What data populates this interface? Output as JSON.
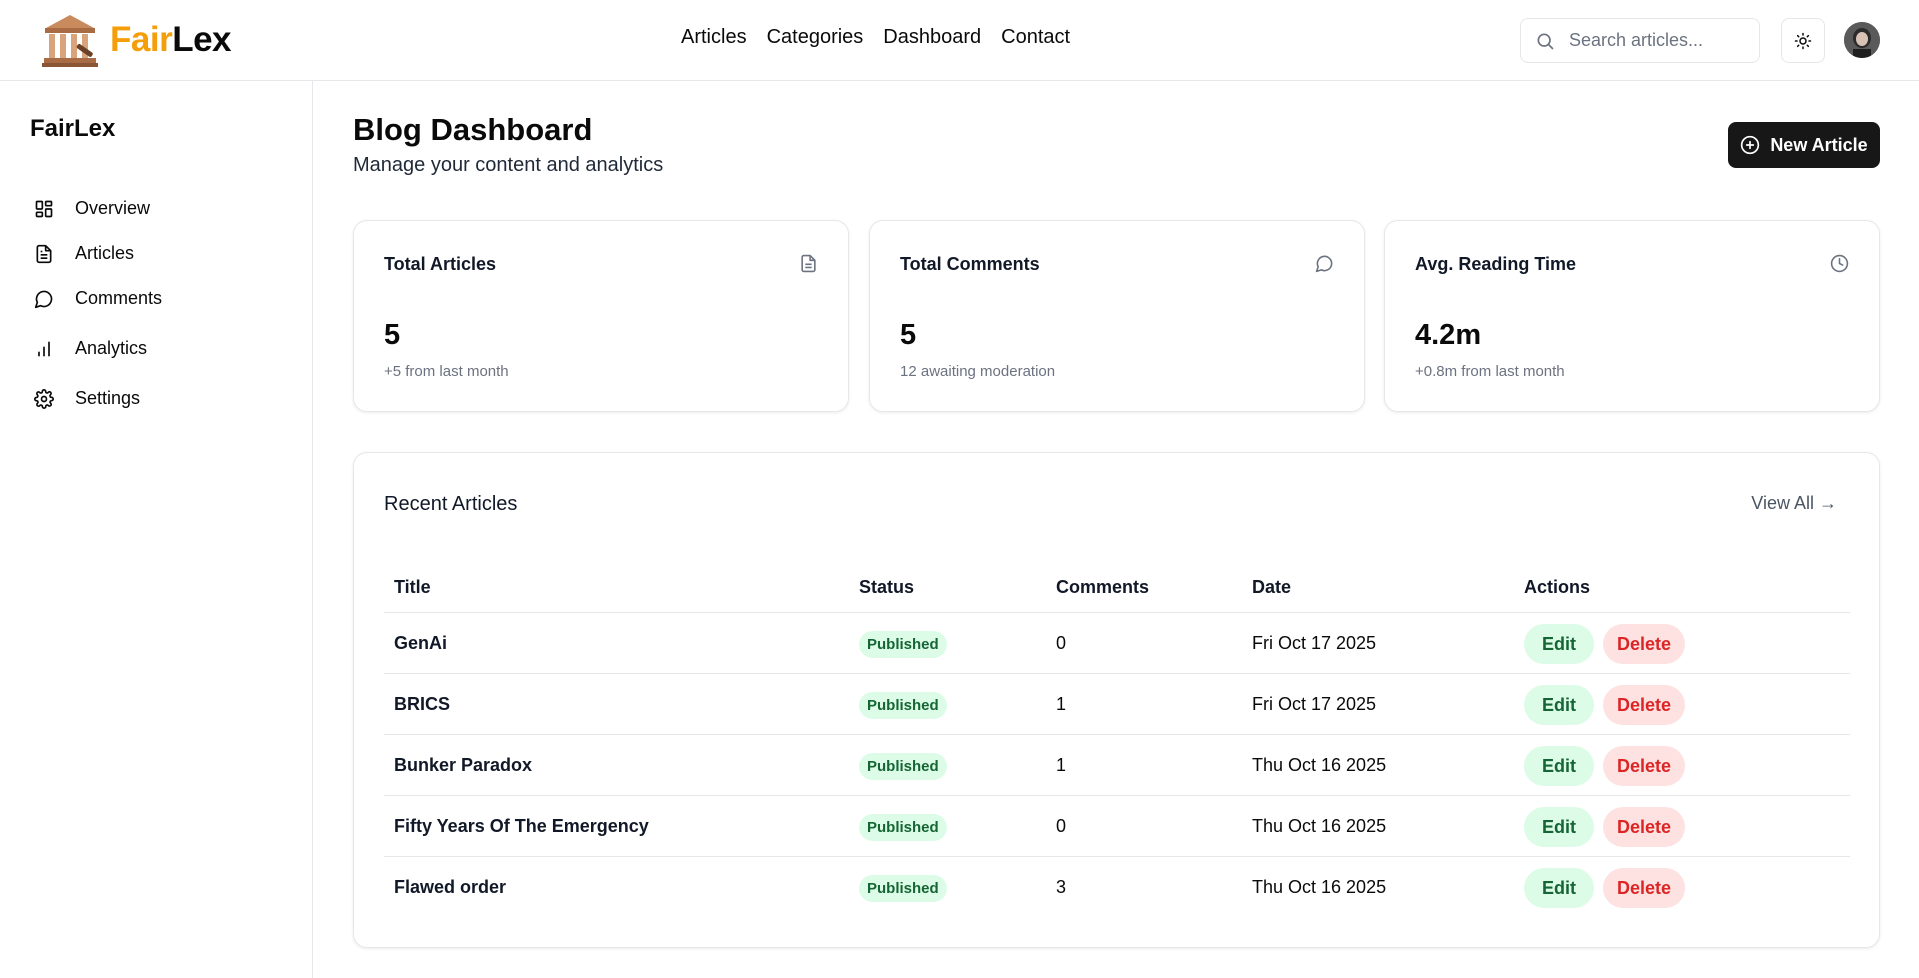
{
  "brand": {
    "part1": "Fair",
    "part2": "Lex",
    "part1_color": "#f59e0b"
  },
  "topnav": [
    "Articles",
    "Categories",
    "Dashboard",
    "Contact"
  ],
  "search": {
    "placeholder": "Search articles..."
  },
  "sidebar": {
    "title": "FairLex",
    "items": [
      {
        "label": "Overview",
        "icon": "grid-icon"
      },
      {
        "label": "Articles",
        "icon": "file-text-icon"
      },
      {
        "label": "Comments",
        "icon": "message-circle-icon"
      },
      {
        "label": "Analytics",
        "icon": "bar-chart-icon"
      },
      {
        "label": "Settings",
        "icon": "gear-icon"
      }
    ]
  },
  "main": {
    "title": "Blog Dashboard",
    "subtitle": "Manage your content and analytics",
    "new_article_label": "New Article"
  },
  "stats": [
    {
      "label": "Total Articles",
      "value": "5",
      "note": "+5 from last month",
      "icon": "file-text-icon"
    },
    {
      "label": "Total Comments",
      "value": "5",
      "note": "12 awaiting moderation",
      "icon": "message-circle-icon"
    },
    {
      "label": "Avg. Reading Time",
      "value": "4.2m",
      "note": "+0.8m from last month",
      "icon": "clock-icon"
    }
  ],
  "recent": {
    "title": "Recent Articles",
    "view_all": "View All →",
    "columns": [
      "Title",
      "Status",
      "Comments",
      "Date",
      "Actions"
    ],
    "rows": [
      {
        "title": "GenAi",
        "status": "Published",
        "comments": "0",
        "date": "Fri Oct 17 2025"
      },
      {
        "title": "BRICS",
        "status": "Published",
        "comments": "1",
        "date": "Fri Oct 17 2025"
      },
      {
        "title": "Bunker Paradox",
        "status": "Published",
        "comments": "1",
        "date": "Thu Oct 16 2025"
      },
      {
        "title": "Fifty Years Of The Emergency",
        "status": "Published",
        "comments": "0",
        "date": "Thu Oct 16 2025"
      },
      {
        "title": "Flawed order",
        "status": "Published",
        "comments": "3",
        "date": "Thu Oct 16 2025"
      }
    ],
    "edit_label": "Edit",
    "delete_label": "Delete"
  },
  "colors": {
    "accent": "#f59e0b",
    "primary_button": "#171717",
    "badge_bg": "#dcfce7",
    "badge_text": "#166534",
    "delete_bg": "#fee2e2",
    "delete_text": "#dc2626"
  }
}
